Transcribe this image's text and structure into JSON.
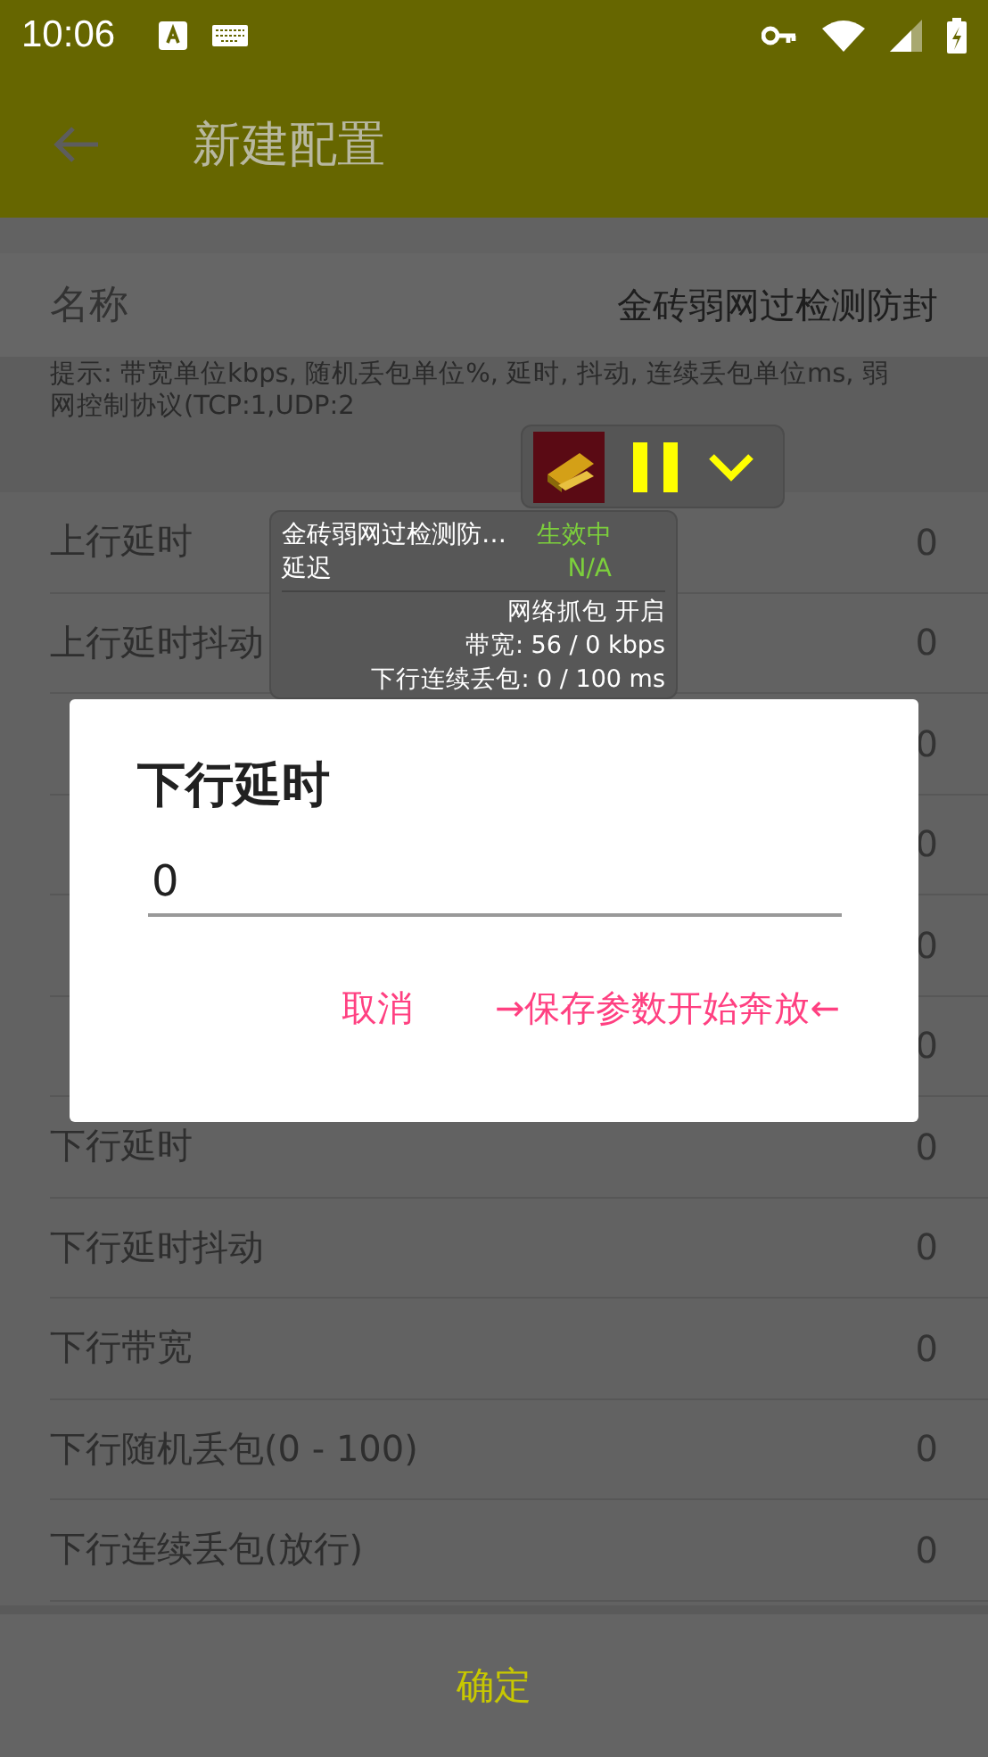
{
  "status_bar": {
    "time": "10:06"
  },
  "app_bar": {
    "title": "新建配置"
  },
  "name_field": {
    "label": "名称",
    "value": "金砖弱网过检测防封"
  },
  "hint": "提示: 带宽单位kbps, 随机丢包单位%, 延时, 抖动, 连续丢包单位ms, 弱网控制协议(TCP:1,UDP:2",
  "rows": [
    {
      "label": "上行延时",
      "value": "0"
    },
    {
      "label": "上行延时抖动",
      "value": "0"
    },
    {
      "value": "0"
    },
    {
      "value": "0"
    },
    {
      "value": "0"
    },
    {
      "value": "0"
    },
    {
      "label": "下行延时",
      "value": "0"
    },
    {
      "label": "下行延时抖动",
      "value": "0"
    },
    {
      "label": "下行带宽",
      "value": "0"
    },
    {
      "label": "下行随机丢包(0 - 100)",
      "value": "0"
    },
    {
      "label": "下行连续丢包(放行)",
      "value": "0"
    }
  ],
  "floating_widget": {
    "title": "金砖弱网过检测防…",
    "status": "生效中",
    "label": "延迟",
    "reading": "N/A",
    "lines": [
      "网络抓包 开启",
      "带宽: 56 / 0 kbps",
      "下行连续丢包: 0 / 100 ms"
    ]
  },
  "dialog": {
    "title": "下行延时",
    "value": "0",
    "buttons": [
      "取消",
      "→保存参数开始奔放←"
    ]
  },
  "confirm_button": "确定"
}
